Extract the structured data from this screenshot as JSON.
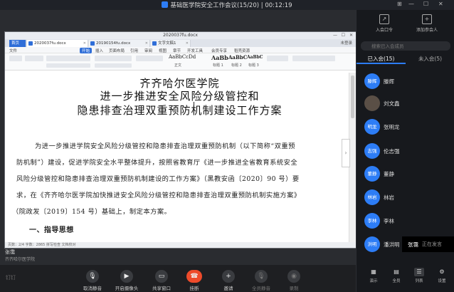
{
  "window": {
    "title": "基础医学院安全工作会议(15/20)",
    "timer": "00:12:19"
  },
  "document": {
    "title": "2020037fu.docx",
    "tabs": [
      "2020037fu.docx",
      "20190154fu.docx",
      "文字文稿1"
    ],
    "login": "未登录",
    "menus": [
      "文件",
      "开始",
      "插入",
      "页面布局",
      "引用",
      "审阅",
      "视图",
      "章节",
      "开发工具",
      "会员专享",
      "稻壳资源"
    ],
    "styles": [
      {
        "sample": "AaBbCcDd",
        "name": "正文"
      },
      {
        "sample": "AaBb",
        "name": "标题 1"
      },
      {
        "sample": "AaBbC",
        "name": "标题 2"
      },
      {
        "sample": "AaBbC",
        "name": "标题 3"
      }
    ],
    "heading": [
      "齐齐哈尔医学院",
      "进一步推进安全风险分级管控和",
      "隐患排查治理双重预防机制建设工作方案"
    ],
    "body": [
      "为进一步推进学院安全风险分级管控和隐患排查治理双重预防机制（以下简称“双重预",
      "防机制”）建设，促进学院安全水平整体提升，按照省教育厅《进一步推进全省教育系统安全",
      "风险分级管控和隐患排查治理双重预防机制建设的工作方案》（黑教安函〔2020〕90 号）要",
      "求，在《齐齐哈尔医学院加快推进安全风险分级管控和隐患排查治理双重预防机制实施方案》",
      "（院政发〔2019〕154 号）基础上，制定本方案。",
      "一、指导思想"
    ],
    "status": "页数：2/4   字数：2865   拼写检查   文档校对"
  },
  "speaker": {
    "name": "张霭",
    "org": "齐齐哈尔医学院"
  },
  "toolbar": {
    "logo": "钉钉",
    "buttons": [
      "取消静音",
      "开启摄像头",
      "共享窗口",
      "挂断",
      "邀请",
      "全员静音",
      "录制"
    ]
  },
  "panel": {
    "top_buttons": [
      "入会口令",
      "添加参会人"
    ],
    "search_placeholder": "搜索已入会成员",
    "tabs": [
      "已入会(15)",
      "未入会(5)"
    ],
    "members": [
      {
        "avatar": "滕辉",
        "name": "滕辉"
      },
      {
        "avatar": "",
        "name": "刘文鑫"
      },
      {
        "avatar": "明龙",
        "name": "张明龙"
      },
      {
        "avatar": "志强",
        "name": "伦志强"
      },
      {
        "avatar": "董静",
        "name": "董静"
      },
      {
        "avatar": "林岩",
        "name": "林岩"
      },
      {
        "avatar": "李林",
        "name": "李林"
      },
      {
        "avatar": "洪明",
        "name": "潘洪明"
      }
    ],
    "speaking": {
      "name": "张霭",
      "status": "正在发言"
    },
    "bottom_buttons": [
      "演示",
      "全员",
      "列表",
      "设置"
    ]
  },
  "colors": {
    "accent": "#2d7df6",
    "hangup": "#ee4b2b",
    "panel_bg": "#17191d"
  }
}
